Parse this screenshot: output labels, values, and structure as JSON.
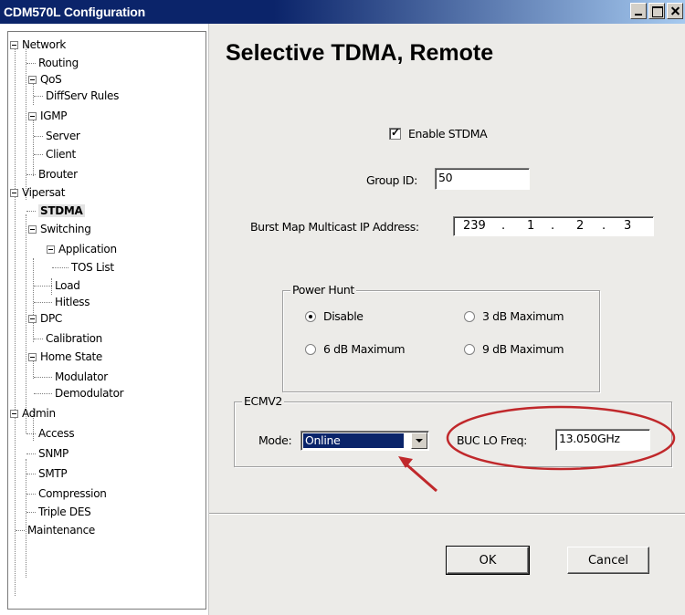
{
  "window": {
    "title": "CDM570L Configuration",
    "controls": [
      "minimize-icon",
      "maximize-icon",
      "close-icon"
    ]
  },
  "tree": [
    {
      "label": "Network",
      "expanded": true
    },
    {
      "label": "Routing"
    },
    {
      "label": "QoS",
      "expanded": true
    },
    {
      "label": "DiffServ Rules"
    },
    {
      "label": "IGMP",
      "expanded": true
    },
    {
      "label": "Server"
    },
    {
      "label": "Client"
    },
    {
      "label": "Brouter"
    },
    {
      "label": "Vipersat",
      "expanded": true
    },
    {
      "label": "STDMA",
      "selected": true
    },
    {
      "label": "Switching",
      "expanded": true
    },
    {
      "label": "Application",
      "expanded": true
    },
    {
      "label": "TOS List"
    },
    {
      "label": "Load"
    },
    {
      "label": "Hitless"
    },
    {
      "label": "DPC",
      "expanded": true
    },
    {
      "label": "Calibration"
    },
    {
      "label": "Home State",
      "expanded": true
    },
    {
      "label": "Modulator"
    },
    {
      "label": "Demodulator"
    },
    {
      "label": "Admin",
      "expanded": true
    },
    {
      "label": "Access"
    },
    {
      "label": "SNMP"
    },
    {
      "label": "SMTP"
    },
    {
      "label": "Compression"
    },
    {
      "label": "Triple DES"
    },
    {
      "label": "Maintenance"
    }
  ],
  "page": {
    "title": "Selective TDMA, Remote",
    "enable_stdma": {
      "label": "Enable STDMA",
      "checked": true
    },
    "group_id": {
      "label": "Group ID:",
      "value": "50"
    },
    "burst_map": {
      "label": "Burst Map Multicast IP Address:",
      "octets": [
        "239",
        "1",
        "2",
        "3"
      ],
      "separator": "."
    },
    "power_hunt": {
      "title": "Power Hunt",
      "options": [
        "Disable",
        "3 dB Maximum",
        "6 dB Maximum",
        "9 dB Maximum"
      ],
      "selected": "Disable"
    },
    "ecmv2": {
      "title": "ECMV2",
      "mode_label": "Mode:",
      "mode_value": "Online",
      "buc_label": "BUC LO Freq:",
      "buc_value": "13.050GHz"
    },
    "buttons": {
      "ok": "OK",
      "cancel": "Cancel"
    }
  },
  "colors": {
    "titlebar": "#0b246a",
    "panel_bg": "#ecebe8",
    "annotation": "#c0282b",
    "selection": "#0a246a"
  }
}
